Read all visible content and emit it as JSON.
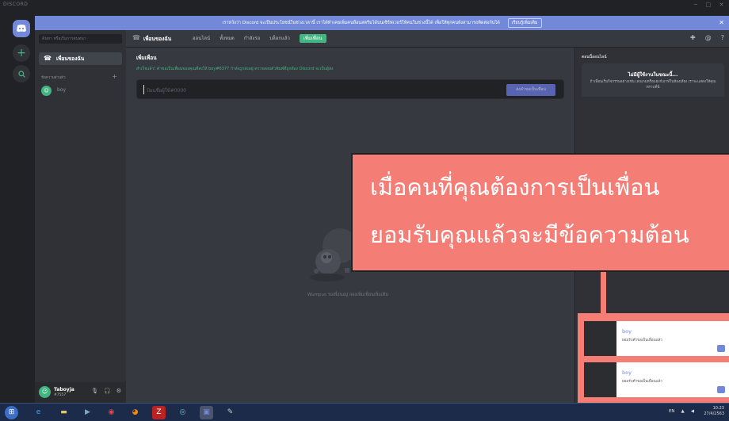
{
  "window": {
    "title": "DISCORD",
    "controls": [
      "─",
      "□",
      "✕"
    ]
  },
  "banner": {
    "text": "เราหวังว่า Discord จะเป็นประโยชน์ในช่วงเวลานี้ เราได้ทำเคยเพิ่มคนถือนสตรีมได้บนเซิร์ฟเวอร์ให้คนในช่วงนี้ได้ เพื่อให้ทุกคนยังสามารถติดต่อกันได้",
    "link": "เรียนรู้เพิ่มเติม",
    "close": "✕"
  },
  "sidebar": {
    "search_placeholder": "ค้นหา หรือเริ่มการสนทนา",
    "friends_label": "เพื่อนของฉัน",
    "dm_header": "ข้อความส่วนตัว",
    "dm_add": "+",
    "dms": [
      {
        "name": "boy"
      }
    ]
  },
  "user": {
    "name": "Taboyja",
    "tag": "#7557"
  },
  "topbar": {
    "title": "เพื่อนของฉัน",
    "tabs": [
      "ออนไลน์",
      "ทั้งหมด",
      "กำลังรอ",
      "บล็อกแล้ว"
    ],
    "add_tab": "เพิ่มเพื่อน"
  },
  "add_friend": {
    "title": "เพิ่มเพื่อน",
    "description": "สำเร็จแล้ว! คำขอเป็นเพื่อนของคุณที่ส่งให้ boy#6377 กำลังถูกส่งอยู่ ตรวจสอบตัวพิมพ์ที่ถูกต้อง Discord จะเป็นผู้ส่ง",
    "placeholder": "ป้อนชื่อผู้ใช้#0000",
    "button": "ส่งคำขอเป็นเพื่อน"
  },
  "empty_text": "Wumpus รอเพื่อนอยู่ ลองเพิ่มเพื่อนเพิ่มเติม",
  "right_panel": {
    "title": "ตอนนี้ออนไลน์",
    "card_heading": "ไม่มีผู้ใช้งานในขณะนี้...",
    "card_body": "ถ้าเพื่อนเริ่มกิจกรรมอย่างเช่น เล่นเกมหรือแฮงก์เอาท์ในห้องเสียง เราจะแสดงให้คุณทราบที่นี่"
  },
  "callout": {
    "line1": "เมื่อคนที่คุณต้องการเป็นเพื่อน",
    "line2": "ยอมรับคุณแล้วจะมีข้อความต้อน"
  },
  "notifications": [
    {
      "name": "boy",
      "message": "ยอมรับคำขอเป็นเพื่อนแล้ว"
    },
    {
      "name": "boy",
      "message": "ยอมรับคำขอเป็นเพื่อนแล้ว"
    }
  ],
  "taskbar": {
    "lang": "EN",
    "time": "10:23",
    "date": "27/4/2563"
  },
  "colors": {
    "accent": "#7289da",
    "green": "#43b581",
    "callout": "#f47d76"
  }
}
